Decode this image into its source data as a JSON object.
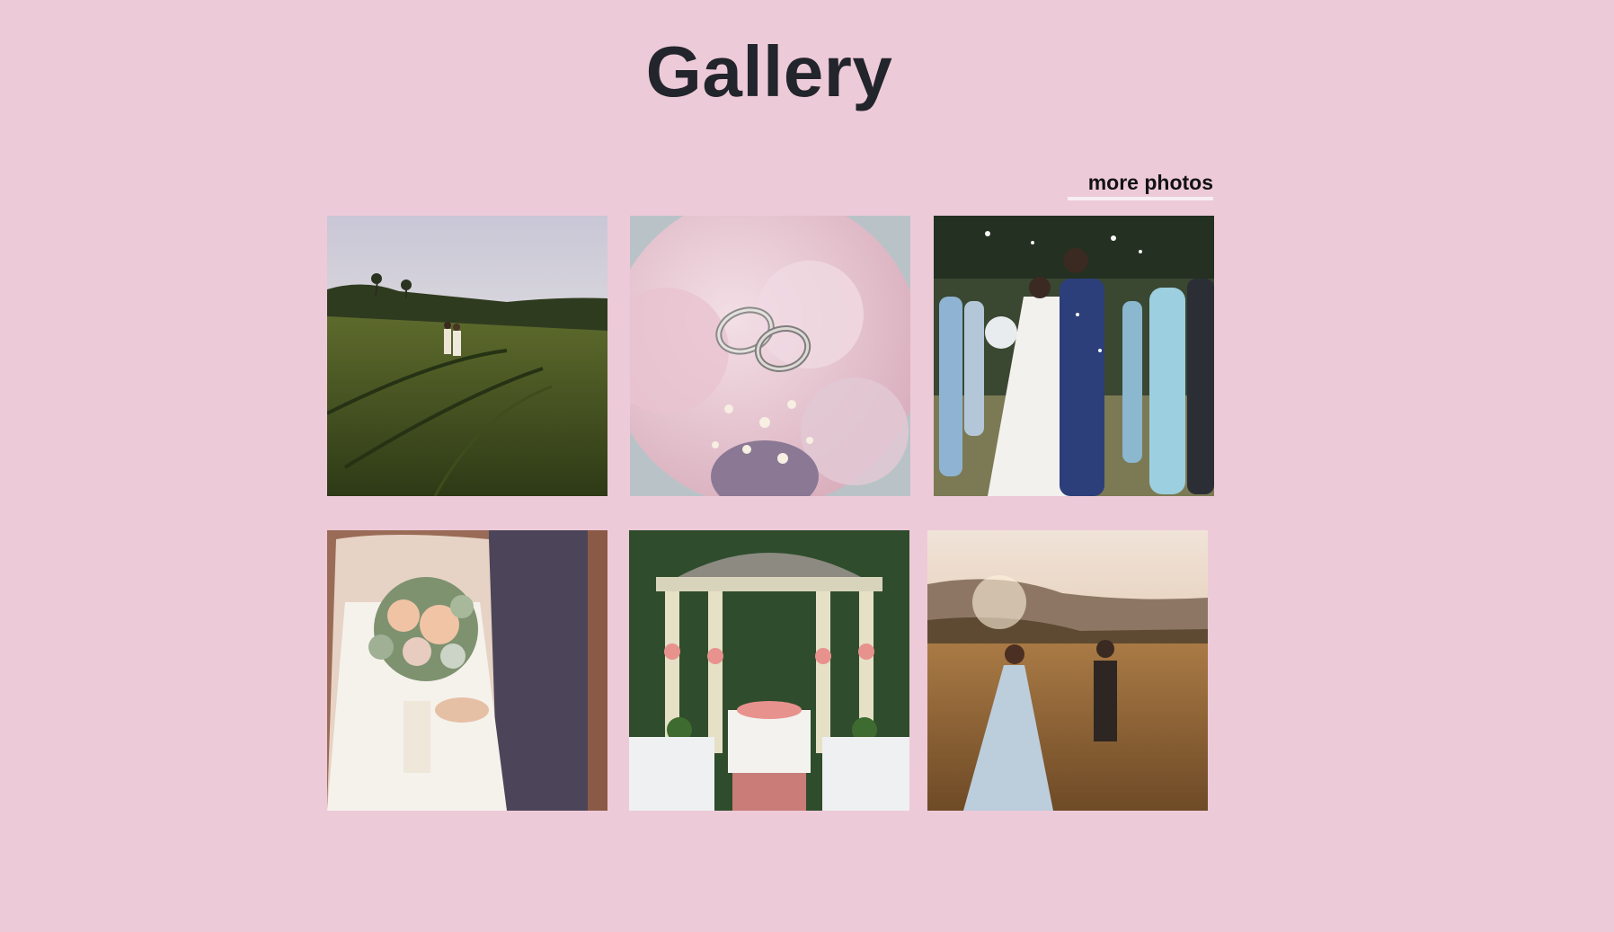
{
  "header": {
    "title": "Gallery"
  },
  "more_link": {
    "label": "more photos"
  },
  "colors": {
    "background": "#edcad8",
    "title": "#22252b",
    "link_underline": "#f7eef3"
  },
  "gallery": {
    "photos": [
      {
        "id": "rice-field-couple",
        "icon": "photo-icon"
      },
      {
        "id": "rings-on-bouquet",
        "icon": "photo-icon"
      },
      {
        "id": "kiss-with-bridesmaids",
        "icon": "photo-icon"
      },
      {
        "id": "bride-holding-bouquet",
        "icon": "photo-icon"
      },
      {
        "id": "gazebo-ceremony",
        "icon": "photo-icon"
      },
      {
        "id": "sunset-meadow-walk",
        "icon": "photo-icon"
      }
    ]
  }
}
